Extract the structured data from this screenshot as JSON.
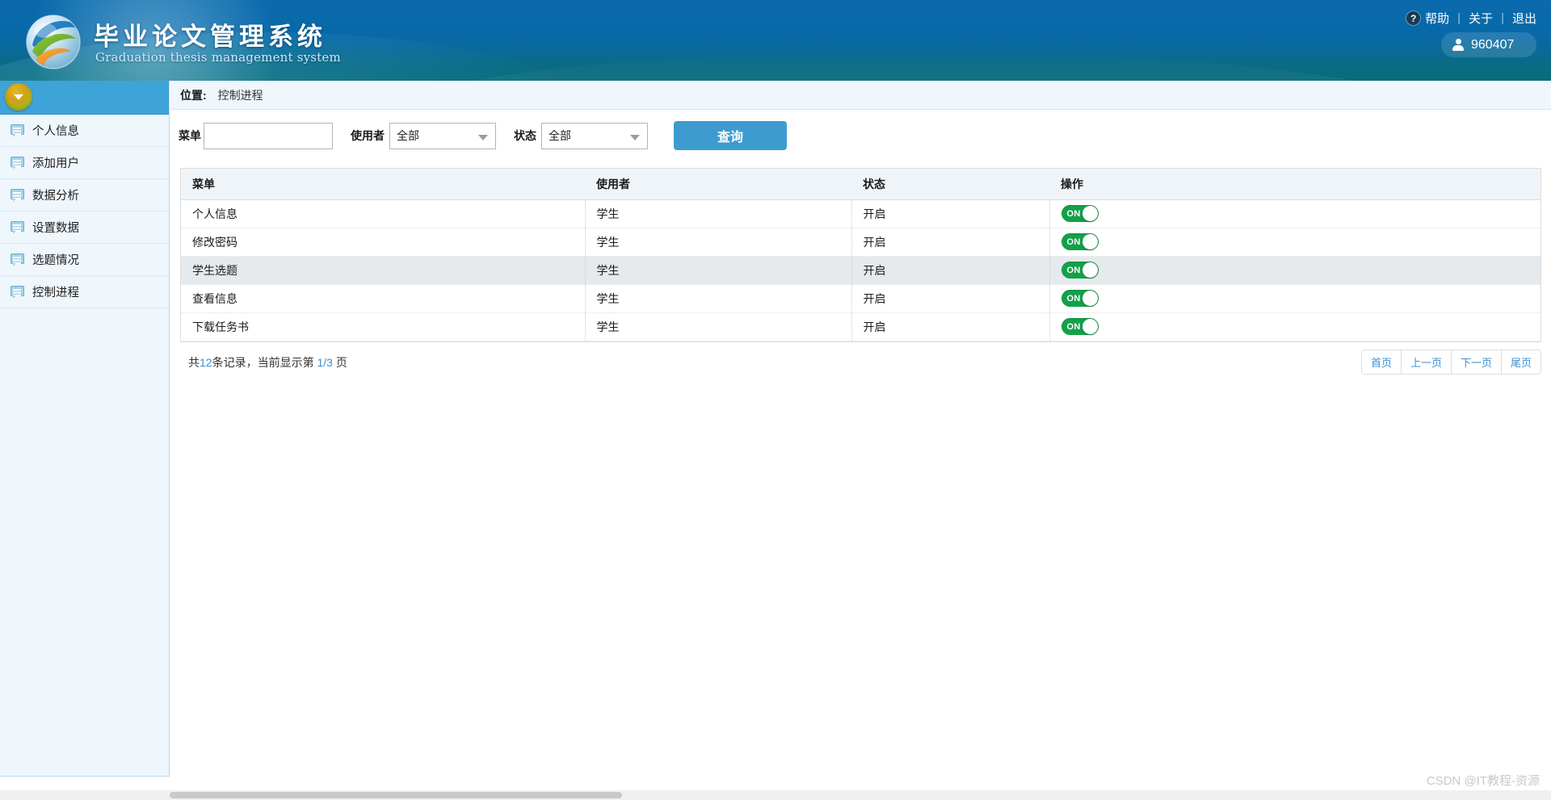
{
  "header": {
    "brand_cn": "毕业论文管理系统",
    "brand_en": "Graduation thesis management system",
    "logo_icon": "globe-logo-icon",
    "help_icon": "question-mark-icon",
    "links": [
      {
        "label": "帮助",
        "name": "help-link"
      },
      {
        "label": "关于",
        "name": "about-link"
      },
      {
        "label": "退出",
        "name": "logout-link"
      }
    ],
    "separator": "|",
    "user": {
      "icon": "user-icon",
      "name": "960407"
    }
  },
  "sidebar": {
    "collapse_icon": "chevron-down-icon",
    "items": [
      {
        "label": "个人信息",
        "icon": "chat-bubble-icon"
      },
      {
        "label": "添加用户",
        "icon": "chat-bubble-icon"
      },
      {
        "label": "数据分析",
        "icon": "chat-bubble-icon"
      },
      {
        "label": "设置数据",
        "icon": "chat-bubble-icon"
      },
      {
        "label": "选题情况",
        "icon": "chat-bubble-icon"
      },
      {
        "label": "控制进程",
        "icon": "chat-bubble-icon"
      }
    ]
  },
  "breadcrumb": {
    "label": "位置:",
    "current": "控制进程"
  },
  "filters": {
    "menu": {
      "label": "菜单",
      "value": "",
      "placeholder": ""
    },
    "user": {
      "label": "使用者",
      "selected": "全部",
      "caret_icon": "chevron-down-icon"
    },
    "status": {
      "label": "状态",
      "selected": "全部",
      "caret_icon": "chevron-down-icon"
    },
    "query_button": "查询"
  },
  "table": {
    "columns": [
      "菜单",
      "使用者",
      "状态",
      "操作"
    ],
    "rows": [
      {
        "menu": "个人信息",
        "user": "学生",
        "status": "开启",
        "toggle": "ON",
        "highlighted": false
      },
      {
        "menu": "修改密码",
        "user": "学生",
        "status": "开启",
        "toggle": "ON",
        "highlighted": false
      },
      {
        "menu": "学生选题",
        "user": "学生",
        "status": "开启",
        "toggle": "ON",
        "highlighted": true
      },
      {
        "menu": "查看信息",
        "user": "学生",
        "status": "开启",
        "toggle": "ON",
        "highlighted": false
      },
      {
        "menu": "下载任务书",
        "user": "学生",
        "status": "开启",
        "toggle": "ON",
        "highlighted": false
      }
    ]
  },
  "pagination": {
    "info_prefix": "共",
    "total_records": "12",
    "info_middle": "条记录，当前显示第",
    "current_page": "1/3",
    "info_suffix": "页",
    "buttons": [
      {
        "label": "首页",
        "name": "pagination-first"
      },
      {
        "label": "上一页",
        "name": "pagination-prev"
      },
      {
        "label": "下一页",
        "name": "pagination-next"
      },
      {
        "label": "尾页",
        "name": "pagination-last"
      }
    ]
  },
  "watermark": "CSDN @IT教程-资源",
  "colors": {
    "header_top": "#0a6aad",
    "header_bottom": "#0a6b7a",
    "sidebar_bg": "#eff6fc",
    "sidebar_top_bar": "#3ea3d8",
    "accent_blue": "#3d9bd0",
    "toggle_green": "#14a049",
    "link_blue": "#3d8fd0",
    "row_highlight": "#e4eaee"
  }
}
